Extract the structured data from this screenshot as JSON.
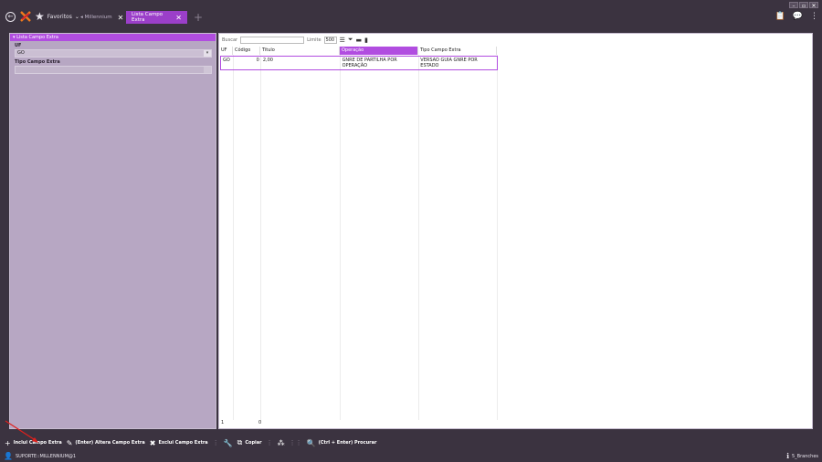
{
  "window": {
    "controls": [
      "–",
      "▫",
      "✕"
    ]
  },
  "header": {
    "favorites_label": "Favoritos",
    "tabs": [
      {
        "label": "Millennium",
        "active": false
      },
      {
        "label": "Lista Campo Extra",
        "active": true
      }
    ]
  },
  "filters": {
    "section_title": "Lista Campo Extra",
    "uf_label": "UF",
    "uf_value": "GO",
    "tipo_label": "Tipo Campo Extra",
    "tipo_value": ""
  },
  "grid": {
    "search_label": "Buscar",
    "limit_label": "Limite",
    "limit_value": "500",
    "columns": [
      "UF",
      "Código",
      "Titulo",
      "Operação",
      "Tipo Campo Extra"
    ],
    "rows": [
      {
        "uf": "GO",
        "codigo": "0",
        "titulo": "2,00",
        "operacao": "GNRE DE PARTILHA POR OPERAÇÃO",
        "tipo": "VERSAO GUIA GNRE POR ESTADO"
      }
    ],
    "footer_count": "1",
    "footer_sum": "0"
  },
  "toolbar": {
    "include": "Inclui Campo Extra",
    "alter": "(Enter) Altera Campo Extra",
    "exclude": "Exclui Campo Extra",
    "copy": "Copiar",
    "search": "(Ctrl + Enter) Procurar"
  },
  "status": {
    "user": "SUPORTE::MILLENNIUM@1",
    "branch": "5_Branches"
  },
  "colors": {
    "accent": "#b14de0",
    "tab_active": "#9b3fc9",
    "chrome": "#3b3340",
    "panel": "#b7a7c3"
  }
}
